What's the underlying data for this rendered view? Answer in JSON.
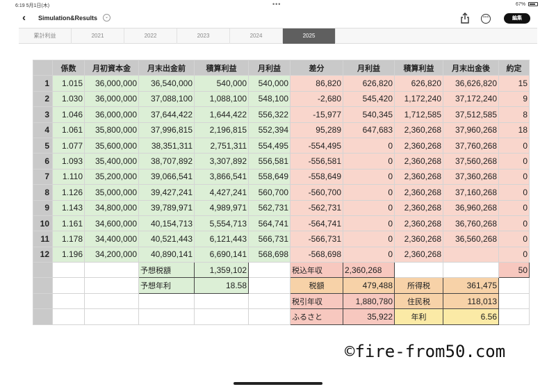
{
  "status": {
    "time": "6:19",
    "date": "5月1日(木)",
    "dots": "•••",
    "battery": "67%"
  },
  "nav": {
    "title": "Simulation&Results",
    "edit_label": "編集"
  },
  "tabs": [
    "累計利益",
    "2021",
    "2022",
    "2023",
    "2024",
    "2025"
  ],
  "active_tab": "2025",
  "headers": [
    "係数",
    "月初資本金",
    "月末出金前",
    "積算利益",
    "月利益",
    "差分",
    "月利益",
    "積算利益",
    "月末出金後",
    "約定"
  ],
  "rows": [
    [
      "1",
      "1.015",
      "36,000,000",
      "36,540,000",
      "540,000",
      "540,000",
      "86,820",
      "626,820",
      "626,820",
      "36,626,820",
      "15"
    ],
    [
      "2",
      "1.030",
      "36,000,000",
      "37,088,100",
      "1,088,100",
      "548,100",
      "-2,680",
      "545,420",
      "1,172,240",
      "37,172,240",
      "9"
    ],
    [
      "3",
      "1.046",
      "36,000,000",
      "37,644,422",
      "1,644,422",
      "556,322",
      "-15,977",
      "540,345",
      "1,712,585",
      "37,512,585",
      "8"
    ],
    [
      "4",
      "1.061",
      "35,800,000",
      "37,996,815",
      "2,196,815",
      "552,394",
      "95,289",
      "647,683",
      "2,360,268",
      "37,960,268",
      "18"
    ],
    [
      "5",
      "1.077",
      "35,600,000",
      "38,351,311",
      "2,751,311",
      "554,495",
      "-554,495",
      "0",
      "2,360,268",
      "37,760,268",
      "0"
    ],
    [
      "6",
      "1.093",
      "35,400,000",
      "38,707,892",
      "3,307,892",
      "556,581",
      "-556,581",
      "0",
      "2,360,268",
      "37,560,268",
      "0"
    ],
    [
      "7",
      "1.110",
      "35,200,000",
      "39,066,541",
      "3,866,541",
      "558,649",
      "-558,649",
      "0",
      "2,360,268",
      "37,360,268",
      "0"
    ],
    [
      "8",
      "1.126",
      "35,000,000",
      "39,427,241",
      "4,427,241",
      "560,700",
      "-560,700",
      "0",
      "2,360,268",
      "37,160,268",
      "0"
    ],
    [
      "9",
      "1.143",
      "34,800,000",
      "39,789,971",
      "4,989,971",
      "562,731",
      "-562,731",
      "0",
      "2,360,268",
      "36,960,268",
      "0"
    ],
    [
      "10",
      "1.161",
      "34,600,000",
      "40,154,713",
      "5,554,713",
      "564,741",
      "-564,741",
      "0",
      "2,360,268",
      "36,760,268",
      "0"
    ],
    [
      "11",
      "1.178",
      "34,400,000",
      "40,521,443",
      "6,121,443",
      "566,731",
      "-566,731",
      "0",
      "2,360,268",
      "36,560,268",
      "0"
    ],
    [
      "12",
      "1.196",
      "34,200,000",
      "40,890,141",
      "6,690,141",
      "568,698",
      "-568,698",
      "0",
      "2,360,268",
      "",
      "0"
    ]
  ],
  "summary": {
    "expected_tax_label": "予想税額",
    "expected_tax_value": "1,359,102",
    "expected_yield_label": "予想年利",
    "expected_yield_value": "18.58",
    "pretax_income_label": "税込年収",
    "pretax_income_value": "2,360,268",
    "trades_total": "50",
    "tax_label": "税額",
    "tax_value": "479,488",
    "income_tax_label": "所得税",
    "income_tax_value": "361,475",
    "aftertax_income_label": "税引年収",
    "aftertax_income_value": "1,880,780",
    "resident_tax_label": "住民税",
    "resident_tax_value": "118,013",
    "furusato_label": "ふるさと",
    "furusato_value": "35,922",
    "annual_yield_label": "年利",
    "annual_yield_value": "6.56"
  },
  "watermark": "©fire-from50.com",
  "colors": {
    "green": "#dcefd6",
    "salmon": "#f9d6cc",
    "header": "#c9c9c9",
    "orange": "#f7d2a8",
    "yellow": "#fbeaa6"
  }
}
